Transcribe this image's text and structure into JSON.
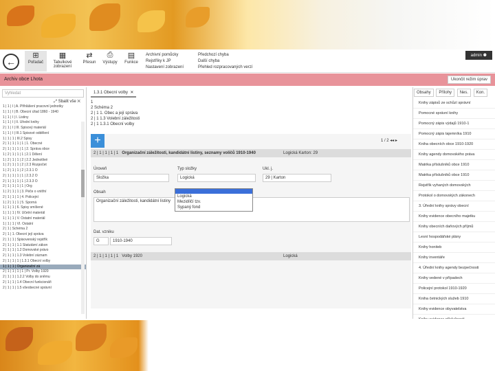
{
  "toolbar": {
    "buttons": [
      {
        "label": "Pořadač",
        "icon": "tree-icon"
      },
      {
        "label": "Tabulkové zobrazení",
        "icon": "table-icon"
      },
      {
        "label": "Přesun",
        "icon": "arrows-icon"
      },
      {
        "label": "Výstupy",
        "icon": "print-icon"
      },
      {
        "label": "Funkce",
        "icon": "calculator-icon"
      }
    ],
    "list1": [
      "Archivní pomůcky",
      "Rejstříky k JP",
      "Nastavení zobrazení"
    ],
    "list2": [
      "Předchozí chyba",
      "Další chyba",
      "Přehled rozpracovaných verzí"
    ],
    "user": "admin"
  },
  "header": {
    "title": "Archiv obce Lhota",
    "end_mode": "Ukončit režim úprav"
  },
  "left": {
    "search_placeholder": "Vyhledat",
    "collapse": "Sbalit vše",
    "rows": [
      "1 | 1 | I | A. Přihlášení pracovní jednotky",
      "1 | 1 | I | B. Obecní úřad 1860 - 1940",
      "1 | 1 | I | I. Listiny",
      "1 | 1 | I | II. Úřední knihy",
      "2 | 1 | I | III. Spisový materiál",
      "1 | 1 | I | III.1 Spisové oddělení",
      "1 | 1 | 1 | III.2 Spisy",
      "2 | 1 | 1 | 1 | 1 | 1. Obecné",
      "2 | 1 | 1 | 1 | 1 | 2. Správa obce",
      "1 | 2 | 1 | 1 | 1 | 2.1 Dělení",
      "1 | 2 | 1 | 1 | 2 | 2.2 Jednotlivé",
      "1 | 2 | 1 | 1 | 2 | 2.3 Rozpočet",
      "1 | 2 | 1 | 1 | 2 | 2.3.1 O",
      "2 | 1 | 1 | 1 | 1 | 2.3.2 O",
      "2 | 1 | 1 | 1 | 1 | 2.3.3 O",
      "2 | 1 | 1 | 1 | 1 | Org",
      "1 | 2 | 1 | 1 | 3. Péče o vnitřní",
      "2 | 1 | 1 | 1 | 4. Policejní",
      "1 | 2 | 1 | 1 | 5. Sporná",
      "1 | 1 | 1 | 6. Spisy smíšené",
      "1 | 1 | 1 | IV. Účetní materiál",
      "1 | 1 | 1 | V. Ostatní materiál",
      "1 | 1 | 1 | VI. Ostatní",
      "2 | 1 | Schéma 2",
      "2 | 1 | 1. Obecní její správa",
      "2 | 1 | 1 | Spisovenský rejstřík",
      "2 | 1 | 1 | 1.1 Statutární zákon",
      "2 | 1 | 1 | 1.2 Domovské právo",
      "2 | 1 | 1 | 1.3 Volební záznam",
      "2 | 1 | 1 | 1 | 1.3.1 Obecní volby",
      "1 | 1 | 1 | Organizační zá",
      "2 | 1 | 1 | 1 | 1 | Pr. Volby 1920",
      "2 | 1 | 1 | 1.2.2 Volby do sněmu",
      "2 | 1 | 1 | 1.4 Obecní funkcionáři",
      "2 | 1 | 1 | 1.5 všeobecné správní"
    ],
    "selected_index": 30
  },
  "middle": {
    "tab_label": "1.3.1 Obecní volby",
    "tree2": [
      "1",
      "2 Schéma 2",
      "2 | 1 1. Obec a její správa",
      "2 | 1 1.3 Volební záležitosti",
      "2 | 1 1.3.1 Obecní volby"
    ],
    "row1": {
      "num": "2 | 1 | 1 | 1 | 1",
      "title": "Organizační záležitosti, kandidátní listiny, seznamy voličů 1910-1940",
      "right": "Logická Karton: 29"
    },
    "pager": "1 / 2",
    "section_label": "Úroveň",
    "section_value": "Složka",
    "type_label": "Typ složky",
    "type_value": "Logická",
    "unit_label": "Ukl. j.",
    "unit_value": "29 | Karton",
    "content_label": "Obsah",
    "content_value": "Organizační záležitosti, kandidátní listiny",
    "date_label": "Dat. vzniku",
    "date_prefix": "G",
    "date_value": "1910-1940",
    "row2": {
      "num": "2 | 1 | 1 | 1 | 1",
      "title": "Volby 1920",
      "right": "Logická"
    },
    "dropdown": [
      "Logická",
      "Mezidílčí tzv.",
      "Sypaný fond"
    ]
  },
  "right": {
    "tabs": [
      "Obsahy",
      "Přílohy",
      "Nes.",
      "Kon."
    ],
    "items": [
      "Knihy zápisů ze schůzí správní",
      "Pomocné správní knihy",
      "Pomocný zápis výdajů 1910-1",
      "Pomocný zápis tajemníka 1910",
      "Kniha obecních obce 1910-1920",
      "Knihy agendy domovského práva",
      "Matrika příslušníků obce 1910",
      "Matrika příslušníků obce 1910",
      "Rejstřík vyhaných domovských",
      "Protokol o domovských zákonech",
      "3. Úřední knihy správy obecní",
      "Knihy evidence obecního majetku",
      "Knihy obecních daňových příjmů",
      "Lesní hospodářské plány",
      "Knihy honiteb",
      "Knihy inventáře",
      "4. Úřední knihy agendy bezpečnosti",
      "Knihy vedené v případech",
      "Policejní protokol 1910-1920",
      "Kniha četnických služeb 1910",
      "Knihy evidence obyvatelstva",
      "Knihy evidence příslušnosti",
      "Knihy evidence návštěvníků",
      "Kniha hlášení pobytu osob 1910"
    ]
  }
}
